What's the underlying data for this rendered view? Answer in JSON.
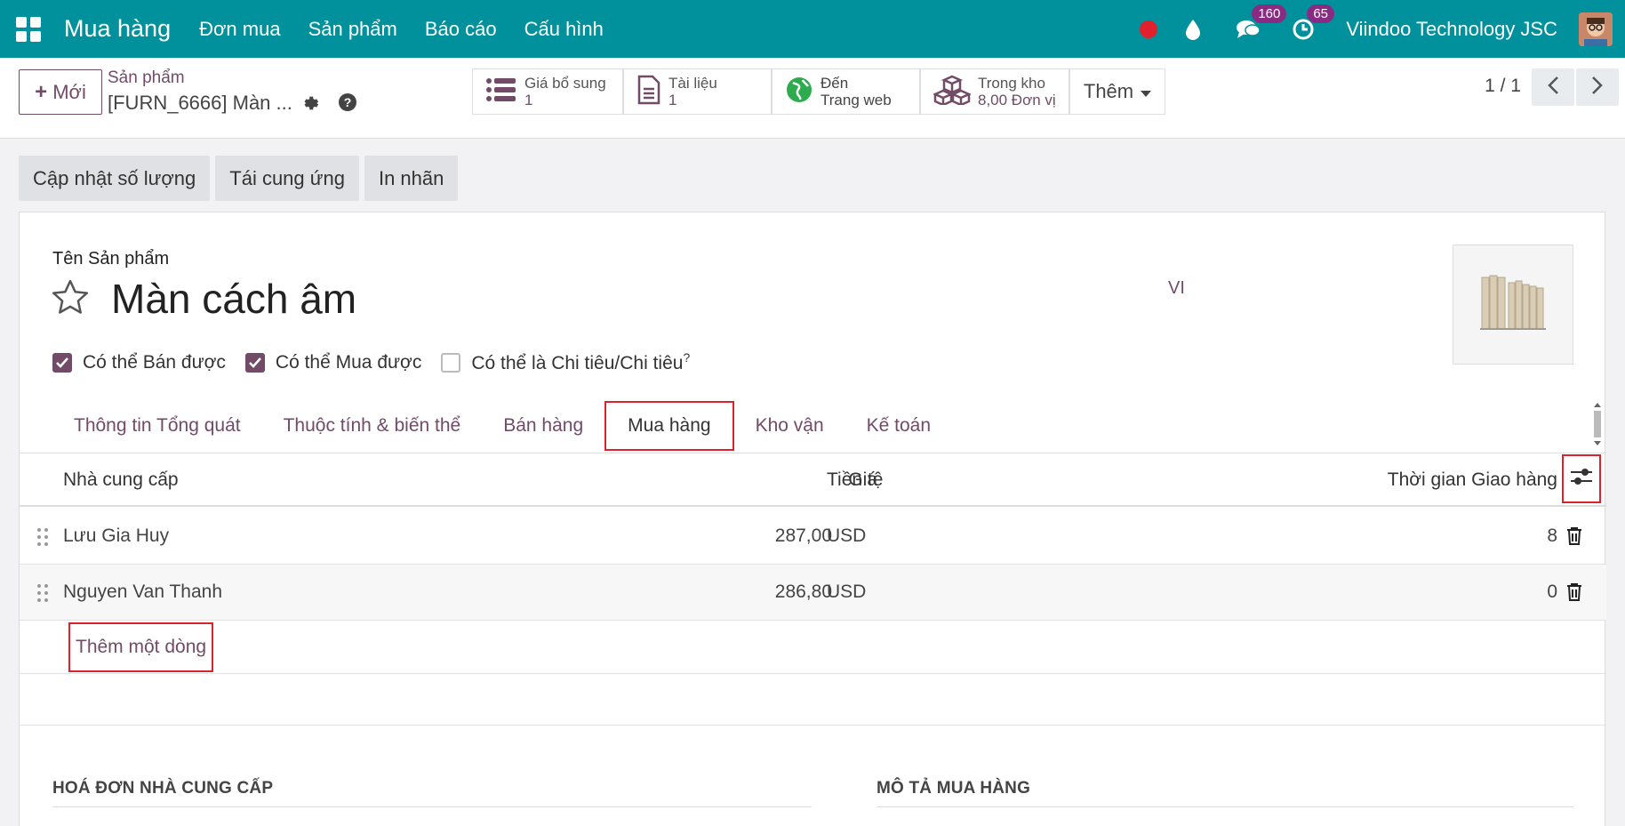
{
  "topbar": {
    "brand": "Mua hàng",
    "menu": [
      "Đơn mua",
      "Sản phẩm",
      "Báo cáo",
      "Cấu hình"
    ],
    "messages_count": "160",
    "activities_count": "65",
    "company": "Viindoo Technology JSC"
  },
  "control": {
    "new_label": "Mới",
    "breadcrumb_parent": "Sản phẩm",
    "breadcrumb_current": "[FURN_6666] Màn ...",
    "smart_buttons": [
      {
        "label": "Giá bổ sung",
        "value": "1"
      },
      {
        "label": "Tài liệu",
        "value": "1"
      },
      {
        "label": "Đến",
        "value": "Trang web"
      },
      {
        "label": "Trong kho",
        "value": "8,00 Đơn vị"
      }
    ],
    "more_label": "Thêm",
    "pager": "1 / 1"
  },
  "actions": [
    "Cập nhật số lượng",
    "Tái cung ứng",
    "In nhãn"
  ],
  "form": {
    "name_label": "Tên Sản phẩm",
    "product_name": "Màn cách âm",
    "lang": "VI",
    "checkboxes": [
      {
        "label": "Có thể Bán được",
        "checked": true
      },
      {
        "label": "Có thể Mua được",
        "checked": true
      },
      {
        "label": "Có thể là Chi tiêu/Chi tiêu",
        "checked": false
      }
    ],
    "help_mark": "?",
    "tabs": [
      "Thông tin Tổng quát",
      "Thuộc tính & biến thể",
      "Bán hàng",
      "Mua hàng",
      "Kho vận",
      "Kế toán"
    ],
    "active_tab": "Mua hàng"
  },
  "table": {
    "headers": {
      "vendor": "Nhà cung cấp",
      "price": "Giá",
      "currency": "Tiền tệ",
      "lead_time": "Thời gian Giao hàng"
    },
    "rows": [
      {
        "vendor": "Lưu Gia Huy",
        "price": "287,00",
        "currency": "USD",
        "lead_time": "8"
      },
      {
        "vendor": "Nguyen Van Thanh",
        "price": "286,80",
        "currency": "USD",
        "lead_time": "0"
      }
    ],
    "add_line": "Thêm một dòng"
  },
  "sections": {
    "vendor_bills": "HOÁ ĐƠN NHÀ CUNG CẤP",
    "purchase_description": "MÔ TẢ MUA HÀNG"
  },
  "colors": {
    "topbar": "#00919c",
    "primary": "#714b67",
    "highlight": "#d9232d"
  }
}
